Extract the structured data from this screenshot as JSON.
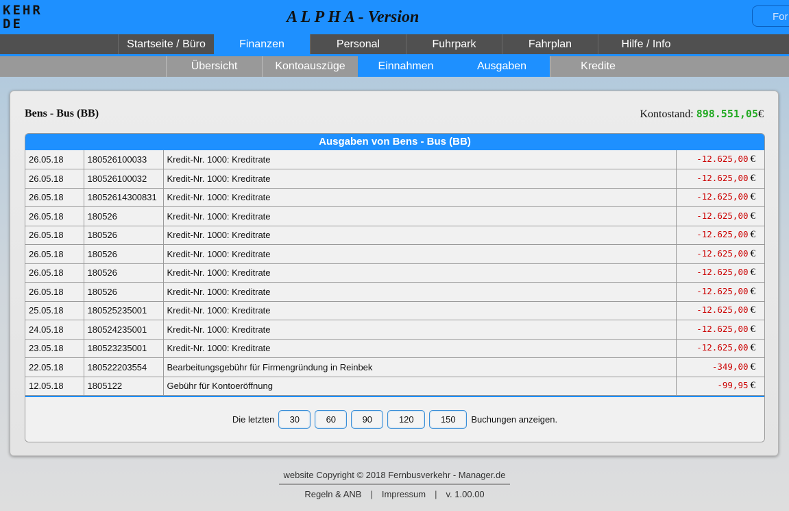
{
  "header": {
    "logo_line1": "KEHR",
    "logo_line2": "DE",
    "title": "A L P H A - Version",
    "right_button": "For"
  },
  "nav_main": [
    {
      "label": "Startseite / Büro",
      "active": false
    },
    {
      "label": "Finanzen",
      "active": true
    },
    {
      "label": "Personal",
      "active": false
    },
    {
      "label": "Fuhrpark",
      "active": false
    },
    {
      "label": "Fahrplan",
      "active": false
    },
    {
      "label": "Hilfe / Info",
      "active": false
    }
  ],
  "nav_sub": [
    {
      "label": "Übersicht",
      "active": false
    },
    {
      "label": "Kontoauszüge",
      "active": false
    },
    {
      "label": "Einnahmen",
      "active": true
    },
    {
      "label": "Ausgaben",
      "active": true
    },
    {
      "label": "Kredite",
      "active": false
    }
  ],
  "panel": {
    "company": "Bens - Bus (BB)",
    "balance_label": "Kontostand:",
    "balance_amount": "898.551,05",
    "balance_currency": "€"
  },
  "table": {
    "title": "Ausgaben von Bens - Bus (BB)",
    "rows": [
      {
        "date": "26.05.18",
        "ref": "180526100033",
        "desc": "Kredit-Nr. 1000: Kreditrate",
        "amount": "-12.625,00",
        "currency": "€"
      },
      {
        "date": "26.05.18",
        "ref": "180526100032",
        "desc": "Kredit-Nr. 1000: Kreditrate",
        "amount": "-12.625,00",
        "currency": "€"
      },
      {
        "date": "26.05.18",
        "ref": "18052614300831",
        "desc": "Kredit-Nr. 1000: Kreditrate",
        "amount": "-12.625,00",
        "currency": "€"
      },
      {
        "date": "26.05.18",
        "ref": "180526",
        "desc": "Kredit-Nr. 1000: Kreditrate",
        "amount": "-12.625,00",
        "currency": "€"
      },
      {
        "date": "26.05.18",
        "ref": "180526",
        "desc": "Kredit-Nr. 1000: Kreditrate",
        "amount": "-12.625,00",
        "currency": "€"
      },
      {
        "date": "26.05.18",
        "ref": "180526",
        "desc": "Kredit-Nr. 1000: Kreditrate",
        "amount": "-12.625,00",
        "currency": "€"
      },
      {
        "date": "26.05.18",
        "ref": "180526",
        "desc": "Kredit-Nr. 1000: Kreditrate",
        "amount": "-12.625,00",
        "currency": "€"
      },
      {
        "date": "26.05.18",
        "ref": "180526",
        "desc": "Kredit-Nr. 1000: Kreditrate",
        "amount": "-12.625,00",
        "currency": "€"
      },
      {
        "date": "25.05.18",
        "ref": "180525235001",
        "desc": "Kredit-Nr. 1000: Kreditrate",
        "amount": "-12.625,00",
        "currency": "€"
      },
      {
        "date": "24.05.18",
        "ref": "180524235001",
        "desc": "Kredit-Nr. 1000: Kreditrate",
        "amount": "-12.625,00",
        "currency": "€"
      },
      {
        "date": "23.05.18",
        "ref": "180523235001",
        "desc": "Kredit-Nr. 1000: Kreditrate",
        "amount": "-12.625,00",
        "currency": "€"
      },
      {
        "date": "22.05.18",
        "ref": "180522203554",
        "desc": "Bearbeitungsgebühr für Firmengründung in Reinbek",
        "amount": "-349,00",
        "currency": "€"
      },
      {
        "date": "12.05.18",
        "ref": "1805122",
        "desc": "Gebühr für Kontoeröffnung",
        "amount": "-99,95",
        "currency": "€"
      }
    ],
    "footer_prefix": "Die letzten",
    "footer_suffix": "Buchungen anzeigen.",
    "page_options": [
      "30",
      "60",
      "90",
      "120",
      "150"
    ]
  },
  "footer": {
    "copyright": "website Copyright © 2018 Fernbusverkehr - Manager.de",
    "links": [
      "Regeln & ANB",
      "Impressum",
      "v. 1.00.00"
    ]
  }
}
